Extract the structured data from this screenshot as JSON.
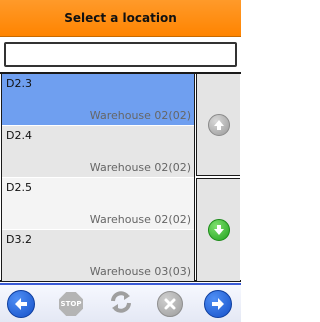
{
  "header": {
    "title": "Select a location"
  },
  "search": {
    "value": "",
    "placeholder": ""
  },
  "locations": [
    {
      "code": "D2.3",
      "warehouse": "Warehouse 02(02)",
      "selected": true
    },
    {
      "code": "D2.4",
      "warehouse": "Warehouse 02(02)",
      "selected": false
    },
    {
      "code": "D2.5",
      "warehouse": "Warehouse 02(02)",
      "selected": false
    },
    {
      "code": "D3.2",
      "warehouse": "Warehouse 03(03)",
      "selected": false
    }
  ],
  "scroll": {
    "up_icon": "arrow-up-gray-icon",
    "down_icon": "arrow-down-green-icon"
  },
  "toolbar": {
    "back_icon": "arrow-left-blue-icon",
    "stop_label": "STOP",
    "refresh_icon": "refresh-gray-icon",
    "cancel_icon": "close-gray-icon",
    "forward_icon": "arrow-right-blue-icon"
  },
  "colors": {
    "header": "#ff8c1a",
    "selected_row": "#6f9ff0",
    "toolbar_accent": "#3b5bd6",
    "nav_blue": "#1f5fd6",
    "down_green": "#2db82a"
  }
}
